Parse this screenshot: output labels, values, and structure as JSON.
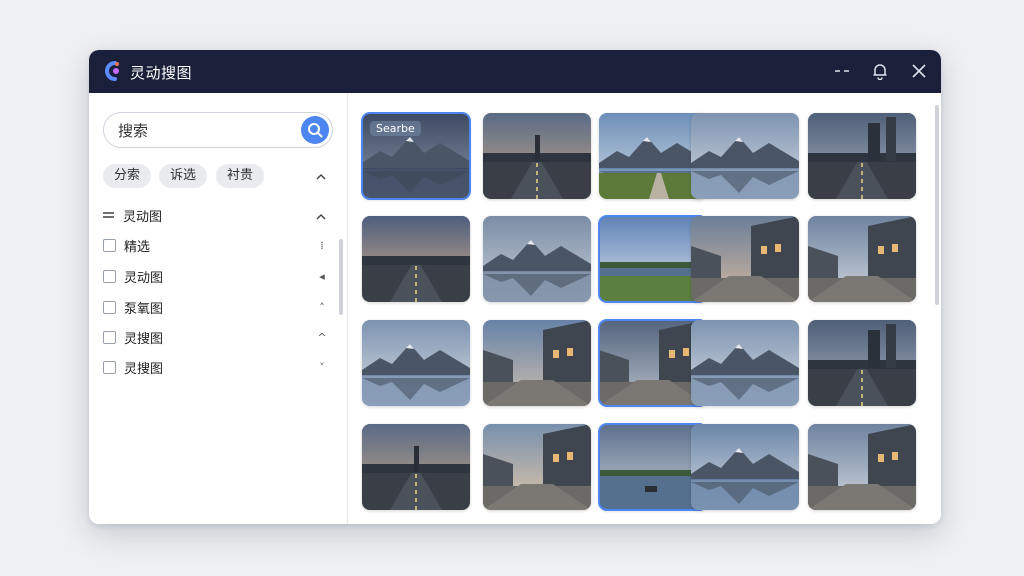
{
  "app": {
    "title": "灵动搜图"
  },
  "colors": {
    "titlebar": "#1a1f3a",
    "accent": "#4d86f0"
  },
  "search": {
    "placeholder": "搜索"
  },
  "chips": [
    {
      "label": "分索"
    },
    {
      "label": "诉选"
    },
    {
      "label": "衬贵"
    }
  ],
  "tree": [
    {
      "label": "灵动图",
      "icon": "menu-icon",
      "mark": "^"
    },
    {
      "label": "精选",
      "mark": "⁞"
    },
    {
      "label": "灵动图",
      "mark": "◂"
    },
    {
      "label": "泵氧图",
      "mark": "˄"
    },
    {
      "label": "灵搜图",
      "mark": "^"
    },
    {
      "label": "灵搜图",
      "mark": "˅"
    }
  ],
  "grid": {
    "tag_label": "Searbe",
    "thumbnails": [
      {
        "scene": "lake-night"
      },
      {
        "scene": "road-tower"
      },
      {
        "scene": "mountain-meadow"
      },
      {
        "scene": "mountain-lake"
      },
      {
        "scene": "city-road"
      },
      {
        "scene": "road-sunset"
      },
      {
        "scene": "fjord"
      },
      {
        "scene": "lake-cloud"
      },
      {
        "scene": "building-plaza"
      },
      {
        "scene": "building-street"
      },
      {
        "scene": "mountain-lake"
      },
      {
        "scene": "street-buildings"
      },
      {
        "scene": "alley"
      },
      {
        "scene": "mountain-lake"
      },
      {
        "scene": "city-road"
      },
      {
        "scene": "road-tower"
      },
      {
        "scene": "building-beach"
      },
      {
        "scene": "lake-boat"
      },
      {
        "scene": "mountain-reflect"
      },
      {
        "scene": "building-street"
      }
    ]
  }
}
